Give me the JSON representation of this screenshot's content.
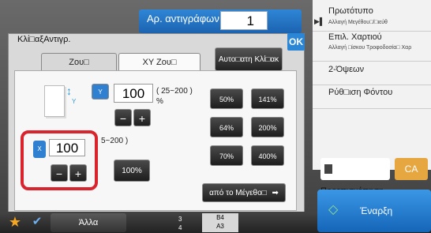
{
  "top": {
    "copies_label": "Αρ. αντιγράφων",
    "copies_value": "1"
  },
  "right_panel": {
    "original": {
      "main": "Πρωτότυπο",
      "sub": "Αλλαγή Μεγέθου□/□ιεύθ"
    },
    "paper": {
      "main": "Επιλ. Χαρτιού",
      "sub": "Αλλαγή □ίσκου Τροφοδοσία□ Χαρ"
    },
    "duplex": "2-Όψεων",
    "background": "Ρύθ□ιση Φόντου"
  },
  "dialog": {
    "title": "Κλί□αξΑντιγρ.",
    "ok": "OK",
    "tabs": [
      "Ζου□",
      "XY Ζου□"
    ],
    "auto_button": "Αυτο□ατη Κλί□ακ",
    "y": {
      "key": "Y",
      "value": "100",
      "range": "( 25~200 )",
      "unit": "%"
    },
    "x": {
      "key": "X",
      "value": "100",
      "range": "5~200 )"
    },
    "minus": "−",
    "plus": "+",
    "presets_col1": [
      "50%",
      "64%",
      "70%"
    ],
    "presets_col2": [
      "141%",
      "200%",
      "400%"
    ],
    "reset": "100%",
    "from_size": "από το Μέγεθο□"
  },
  "bottom": {
    "others": "Άλλα",
    "tray_left": [
      "3",
      "4"
    ],
    "tray_right": [
      "B4",
      "A3"
    ],
    "preview": "Προεπισκόπηση",
    "ca": "CA",
    "start": "Έναρξη"
  },
  "colors": {
    "accent": "#2b86d6",
    "highlight": "#d9232d",
    "ca": "#e6a640"
  }
}
